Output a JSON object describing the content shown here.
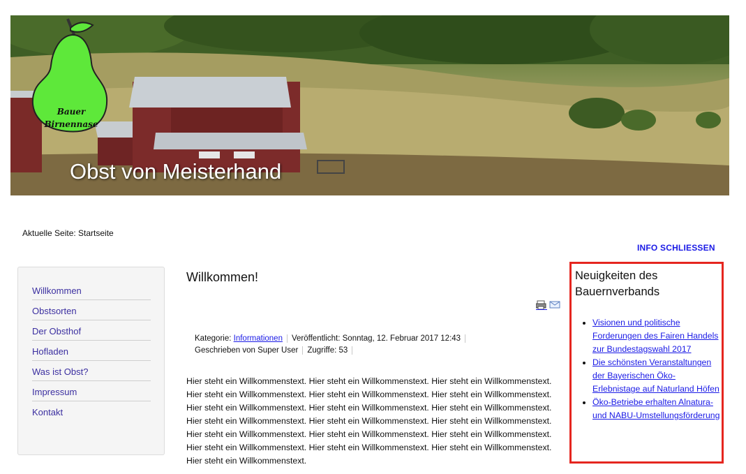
{
  "header": {
    "banner_title": "Obst von Meisterhand",
    "logo_line1": "Bauer",
    "logo_line2": "Birnennase"
  },
  "breadcrumb": "Aktuelle Seite: Startseite",
  "info_close": "INFO SCHLIESSEN",
  "menu": {
    "items": [
      {
        "label": "Willkommen"
      },
      {
        "label": "Obstsorten"
      },
      {
        "label": "Der Obsthof"
      },
      {
        "label": "Hofladen"
      },
      {
        "label": "Was ist Obst?"
      },
      {
        "label": "Impressum"
      },
      {
        "label": "Kontakt"
      }
    ]
  },
  "article": {
    "title": "Willkommen!",
    "category_label": "Kategorie:",
    "category_link": "Informationen",
    "published": "Veröffentlicht: Sonntag, 12. Februar 2017 12:43",
    "author": "Geschrieben von Super User",
    "hits": "Zugriffe: 53",
    "body": "Hier steht ein Willkommenstext. Hier steht ein Willkommenstext. Hier steht ein Willkommenstext. Hier steht ein Willkommenstext. Hier steht ein Willkommenstext. Hier steht ein Willkommenstext. Hier steht ein Willkommenstext. Hier steht ein Willkommenstext. Hier steht ein Willkommenstext. Hier steht ein Willkommenstext. Hier steht ein Willkommenstext. Hier steht ein Willkommenstext. Hier steht ein Willkommenstext. Hier steht ein Willkommenstext. Hier steht ein Willkommenstext. Hier steht ein Willkommenstext. Hier steht ein Willkommenstext. Hier steht ein Willkommenstext. Hier steht ein Willkommenstext."
  },
  "news": {
    "title": "Neuigkeiten des Bauernverbands",
    "items": [
      {
        "label": "Visionen und politische Forderungen des Fairen Handels zur Bundestagswahl 2017"
      },
      {
        "label": "Die schönsten Veranstaltungen der Bayerischen Öko-Erlebnistage auf Naturland Höfen"
      },
      {
        "label": "Öko-Betriebe erhalten Alnatura- und NABU-Umstellungsförderung"
      }
    ]
  },
  "icons": {
    "print": "print-icon",
    "email": "email-icon"
  },
  "colors": {
    "link": "#1a1ae6",
    "menu_link": "#3b2fa0",
    "highlight_border": "#e5261f",
    "logo_pear": "#5ee83a"
  }
}
